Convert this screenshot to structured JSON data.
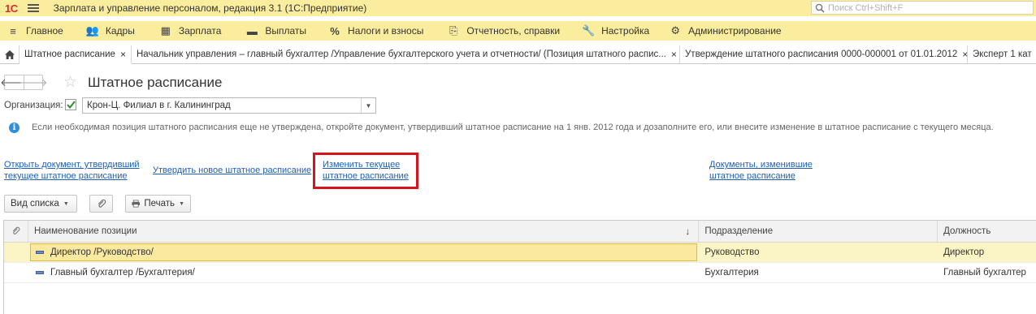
{
  "titlebar": {
    "logo": "1С",
    "app_title": "Зарплата и управление персоналом, редакция 3.1  (1С:Предприятие)",
    "search_placeholder": "Поиск Ctrl+Shift+F"
  },
  "sections": [
    {
      "label": "Главное",
      "icon": "menu-icon"
    },
    {
      "label": "Кадры",
      "icon": "people-icon"
    },
    {
      "label": "Зарплата",
      "icon": "calculator-icon"
    },
    {
      "label": "Выплаты",
      "icon": "card-icon"
    },
    {
      "label": "Налоги и взносы",
      "icon": "percent-icon"
    },
    {
      "label": "Отчетность, справки",
      "icon": "report-icon"
    },
    {
      "label": "Настройка",
      "icon": "wrench-icon"
    },
    {
      "label": "Администрирование",
      "icon": "gear-icon"
    }
  ],
  "tabs": [
    {
      "label": "Штатное расписание",
      "active": true
    },
    {
      "label": "Начальник управления – главный бухгалтер /Управление бухгалтерского учета и отчетности/ (Позиция штатного распис..."
    },
    {
      "label": "Утверждение штатного расписания 0000-000001 от 01.01.2012"
    },
    {
      "label": "Эксперт 1 кат"
    }
  ],
  "form": {
    "title": "Штатное расписание",
    "org_label": "Организация:",
    "org_value": "Крон-Ц. Филиал в г. Калининград",
    "info_text": "Если необходимая позиция штатного расписания еще не утверждена, откройте документ, утвердивший штатное расписание на 1 янв. 2012 года и дозаполните его, или внесите изменение в штатное расписание с текущего месяца.",
    "links": {
      "open_doc_line1": "Открыть документ, утвердивший",
      "open_doc_line2": "текущее штатное расписание",
      "approve_new": "Утвердить новое штатное расписание",
      "change_current_line1": "Изменить текущее",
      "change_current_line2": "штатное расписание",
      "docs_changed_line1": "Документы, изменившие",
      "docs_changed_line2": "штатное расписание"
    }
  },
  "toolbar": {
    "view_list": "Вид списка",
    "print": "Печать"
  },
  "table": {
    "headers": {
      "name": "Наименование позиции",
      "sort_indicator": "↓",
      "department": "Подразделение",
      "position": "Должность"
    },
    "rows": [
      {
        "name": "Директор /Руководство/",
        "department": "Руководство",
        "position": "Директор",
        "selected": true
      },
      {
        "name": "Главный бухгалтер /Бухгалтерия/",
        "department": "Бухгалтерия",
        "position": "Главный бухгалтер"
      }
    ]
  },
  "colors": {
    "panel_bg": "#fbed9e",
    "link": "#1d5fb8",
    "highlight_border": "#d6141b",
    "selected_row": "#fbf4c4"
  }
}
